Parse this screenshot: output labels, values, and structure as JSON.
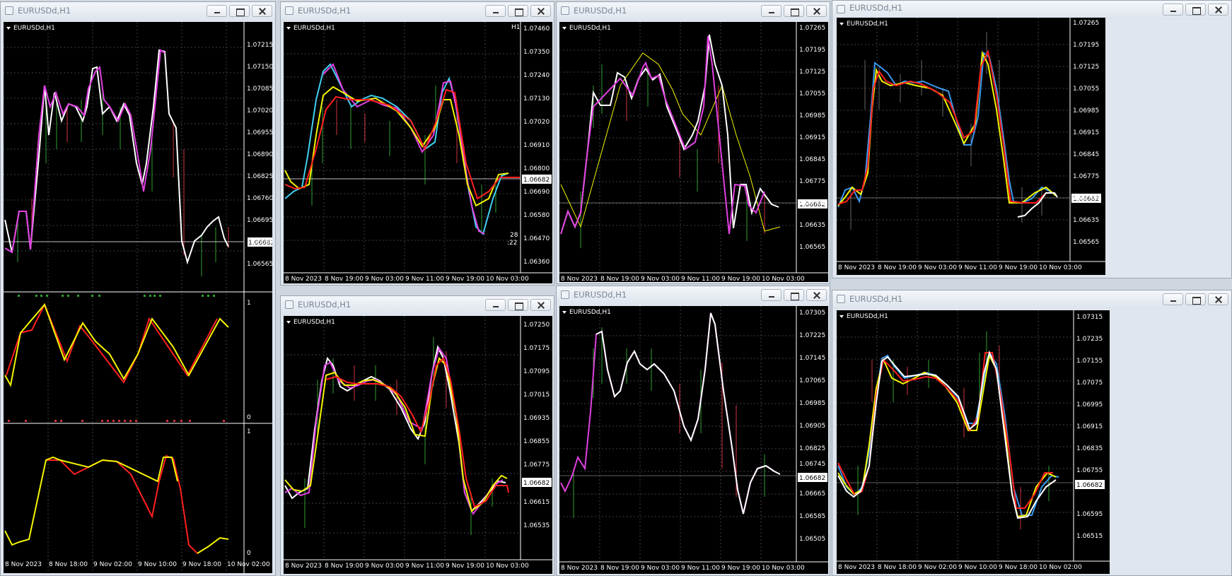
{
  "colors": {
    "bg": "#000000",
    "grid": "#3a3f4a",
    "axis": "#ffffff",
    "text": "#ffffff",
    "price_line": "#bfbfbf"
  },
  "windows": [
    {
      "title": "EURUSDd,H1",
      "chart_label": "EURUSDd,H1",
      "price_label": "1.06682",
      "y_ticks": [
        "1.07215",
        "1.07150",
        "1.07085",
        "1.07020",
        "1.06955",
        "1.06890",
        "1.06825",
        "1.06760",
        "1.06695",
        "1.06630",
        "1.06565"
      ],
      "x_ticks": [
        "8 Nov 2023",
        "8 Nov 18:00",
        "9 Nov 02:00",
        "9 Nov 10:00",
        "9 Nov 18:00",
        "10 Nov 02:00"
      ],
      "sub1_ticks": [
        "1",
        "0"
      ],
      "sub2_ticks": [
        "1",
        "0"
      ]
    },
    {
      "title": "EURUSDd,H1",
      "chart_label": "EURUSDd,H1",
      "price_label": "1.06682",
      "tf_label": "H1",
      "timer_top": "28",
      "timer_bottom": ":22",
      "y_ticks": [
        "1.07460",
        "1.07350",
        "1.07240",
        "1.07130",
        "1.07020",
        "1.06910",
        "1.06800",
        "1.06690",
        "1.06580",
        "1.06470",
        "1.06360"
      ],
      "x_ticks": [
        "8 Nov 2023",
        "8 Nov 19:00",
        "9 Nov 03:00",
        "9 Nov 11:00",
        "9 Nov 19:00",
        "10 Nov 03:00"
      ]
    },
    {
      "title": "EURUSDd,H1",
      "chart_label": "EURUSDd,H1",
      "price_label": "1.06682",
      "y_ticks": [
        "1.07265",
        "1.07195",
        "1.07125",
        "1.07055",
        "1.06985",
        "1.06915",
        "1.06845",
        "1.06775",
        "1.06705",
        "1.06635",
        "1.06565"
      ],
      "x_ticks": [
        "8 Nov 2023",
        "8 Nov 19:00",
        "9 Nov 03:00",
        "9 Nov 11:00",
        "9 Nov 19:00",
        "10 Nov 03:00"
      ]
    },
    {
      "title": "EURUSDd,H1",
      "chart_label": "EURUSDd,H1",
      "price_label": "1.06682",
      "y_ticks": [
        "1.07265",
        "1.07195",
        "1.07125",
        "1.07055",
        "1.06985",
        "1.06915",
        "1.06845",
        "1.06775",
        "1.06705",
        "1.06635",
        "1.06565"
      ],
      "x_ticks": [
        "8 Nov 2023",
        "8 Nov 19:00",
        "9 Nov 03:00",
        "9 Nov 11:00",
        "9 Nov 19:00",
        "10 Nov 03:00"
      ]
    },
    {
      "title": "EURUSDd,H1",
      "chart_label": "EURUSDd,H1",
      "price_label": "1.06682",
      "y_ticks": [
        "1.07250",
        "1.07175",
        "1.07095",
        "1.07015",
        "1.06935",
        "1.06855",
        "1.06775",
        "1.06695",
        "1.06615",
        "1.06535"
      ],
      "x_ticks": [
        "8 Nov 2023",
        "8 Nov 19:00",
        "9 Nov 03:00",
        "9 Nov 11:00",
        "9 Nov 19:00",
        "10 Nov 03:00"
      ]
    },
    {
      "title": "EURUSDd,H1",
      "chart_label": "EURUSDd,H1",
      "price_label": "1.06682",
      "y_ticks": [
        "1.07305",
        "1.07225",
        "1.07145",
        "1.07065",
        "1.06985",
        "1.06905",
        "1.06825",
        "1.06745",
        "1.06665",
        "1.06585",
        "1.06505"
      ],
      "x_ticks": [
        "8 Nov 2023",
        "8 Nov 19:00",
        "9 Nov 03:00",
        "9 Nov 11:00",
        "9 Nov 19:00",
        "10 Nov 03:00"
      ]
    },
    {
      "title": "EURUSDd,H1",
      "chart_label": "EURUSDd,H1",
      "price_label": "1.06682",
      "y_ticks": [
        "1.07315",
        "1.07235",
        "1.07155",
        "1.07075",
        "1.06995",
        "1.06915",
        "1.06835",
        "1.06755",
        "1.06675",
        "1.06595",
        "1.06515"
      ],
      "x_ticks": [
        "8 Nov 2023",
        "8 Nov 18:00",
        "9 Nov 02:00",
        "9 Nov 10:00",
        "9 Nov 18:00",
        "10 Nov 02:00"
      ]
    }
  ]
}
